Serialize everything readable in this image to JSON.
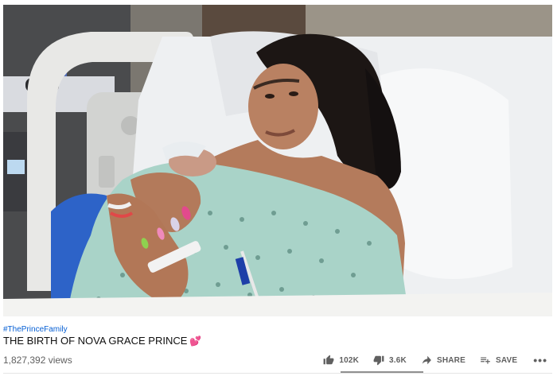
{
  "video": {
    "hashtag": "#ThePrinceFamily",
    "title": "THE BIRTH OF NOVA GRACE PRINCE",
    "title_emoji": "💕",
    "views": "1,827,392 views",
    "like_ratio": 0.966
  },
  "actions": {
    "like_count": "102K",
    "dislike_count": "3.6K",
    "share_label": "SHARE",
    "save_label": "SAVE",
    "more_label": "•••"
  },
  "colors": {
    "hashtag": "#065fd4",
    "text": "#0f0f0f",
    "muted": "#606060",
    "heart": "#e0298d"
  },
  "icons": {
    "like": "thumbs-up-icon",
    "dislike": "thumbs-down-icon",
    "share": "share-arrow-icon",
    "save": "playlist-add-icon",
    "more": "more-horizontal-icon"
  }
}
